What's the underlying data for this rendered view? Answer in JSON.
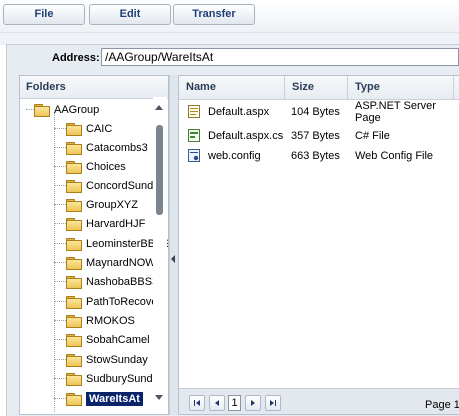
{
  "toolbar": {
    "buttons": [
      {
        "label": "File"
      },
      {
        "label": "Edit"
      },
      {
        "label": "Transfer"
      }
    ]
  },
  "address": {
    "label": "Address:",
    "value": "/AAGroup/WareItsAt"
  },
  "folders": {
    "header": "Folders",
    "root": {
      "label": "AAGroup",
      "icon": "folder-open-icon"
    },
    "items": [
      {
        "label": "CAIC"
      },
      {
        "label": "Catacombs3"
      },
      {
        "label": "Choices"
      },
      {
        "label": "ConcordSunday"
      },
      {
        "label": "GroupXYZ"
      },
      {
        "label": "HarvardHJF"
      },
      {
        "label": "LeominsterBBSS"
      },
      {
        "label": "MaynardNOW"
      },
      {
        "label": "NashobaBBSS"
      },
      {
        "label": "PathToRecovery"
      },
      {
        "label": "RMOKOS"
      },
      {
        "label": "SobahCamel"
      },
      {
        "label": "StowSunday"
      },
      {
        "label": "SudburySunday"
      },
      {
        "label": "WareItsAt",
        "selected": true
      }
    ]
  },
  "files": {
    "columns": [
      "Name",
      "Size",
      "Type"
    ],
    "rows": [
      {
        "name": "Default.aspx",
        "size": "104 Bytes",
        "type_line1": "ASP.NET Server",
        "type_line2": "Page",
        "icon": "aspx-file-icon"
      },
      {
        "name": "Default.aspx.cs",
        "size": "357 Bytes",
        "type_line1": "C# File",
        "type_line2": "",
        "icon": "cs-file-icon"
      },
      {
        "name": "web.config",
        "size": "663 Bytes",
        "type_line1": "Web Config File",
        "type_line2": "",
        "icon": "config-file-icon"
      }
    ]
  },
  "pager": {
    "current_page": "1",
    "page_text": "Page 1"
  },
  "colors": {
    "accent": "#1e3f7a",
    "selection": "#0a246a",
    "folder": "#eec455"
  }
}
